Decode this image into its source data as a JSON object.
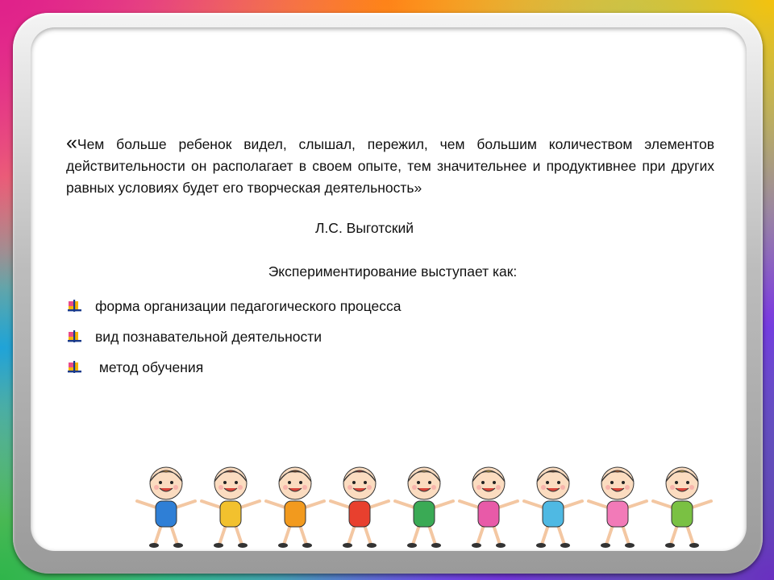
{
  "quote": {
    "open_mark": "«",
    "text": "Чем больше ребенок видел, слышал, пережил, чем большим количеством элементов действительности он располагает в своем опыте, тем значительнее и продуктивнее при других равных условиях будет его творческая деятельность»",
    "author": "Л.С. Выготский"
  },
  "subtitle": "Экспериментирование выступает как:",
  "list_items": [
    {
      "label": "форма организации педагогического процесса",
      "icon": "bullet-icon"
    },
    {
      "label": "вид познавательной деятельности",
      "icon": "bullet-icon"
    },
    {
      "label": " метод обучения",
      "icon": "bullet-icon"
    }
  ],
  "illustration": {
    "icon": "dancing-children-illustration",
    "kid_colors": [
      "#2f7fd6",
      "#f2c12e",
      "#f29a1e",
      "#e8402e",
      "#3aaa55",
      "#e85aa8",
      "#4fb9e3",
      "#f27ab8",
      "#7ac143"
    ]
  }
}
